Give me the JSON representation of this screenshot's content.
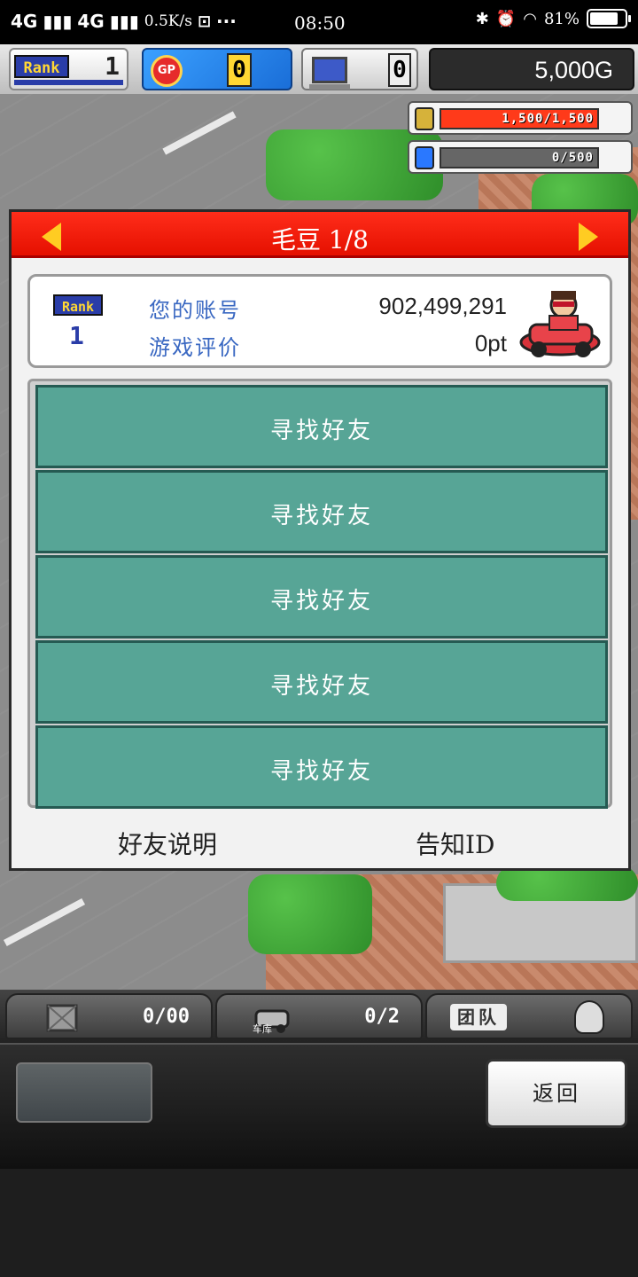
{
  "status_bar": {
    "signal1": "4G",
    "signal2": "4G",
    "net_speed": "0.5K/s",
    "time": "08:50",
    "battery": "81%",
    "battery_level": 0.81
  },
  "hud": {
    "rank_label": "Rank",
    "rank_value": "1",
    "gp_label": "GP",
    "gp_value": "0",
    "pc_value": "0",
    "money": "5,000G"
  },
  "resources": {
    "gold": {
      "text": "1,500/1,500",
      "level": 1.0,
      "color": "#ff3a1a"
    },
    "energy": {
      "text": "0/500",
      "level": 0.0,
      "color": "#2a78ff"
    }
  },
  "dialog": {
    "title": "毛豆 1/8",
    "rank_label": "Rank",
    "rank_value": "1",
    "account_label": "您的账号",
    "account_value": "902,499,291",
    "rating_label": "游戏评价",
    "rating_value": "0pt",
    "slots": [
      "寻找好友",
      "寻找好友",
      "寻找好友",
      "寻找好友",
      "寻找好友"
    ],
    "footer_left": "好友说明",
    "footer_right": "告知ID"
  },
  "bottom_tabs": {
    "tab1_count": "0/00",
    "tab2_label": "车库",
    "tab2_count": "0/2",
    "tab3_label": "团队"
  },
  "bottom_panel": {
    "back_label": "返回"
  }
}
